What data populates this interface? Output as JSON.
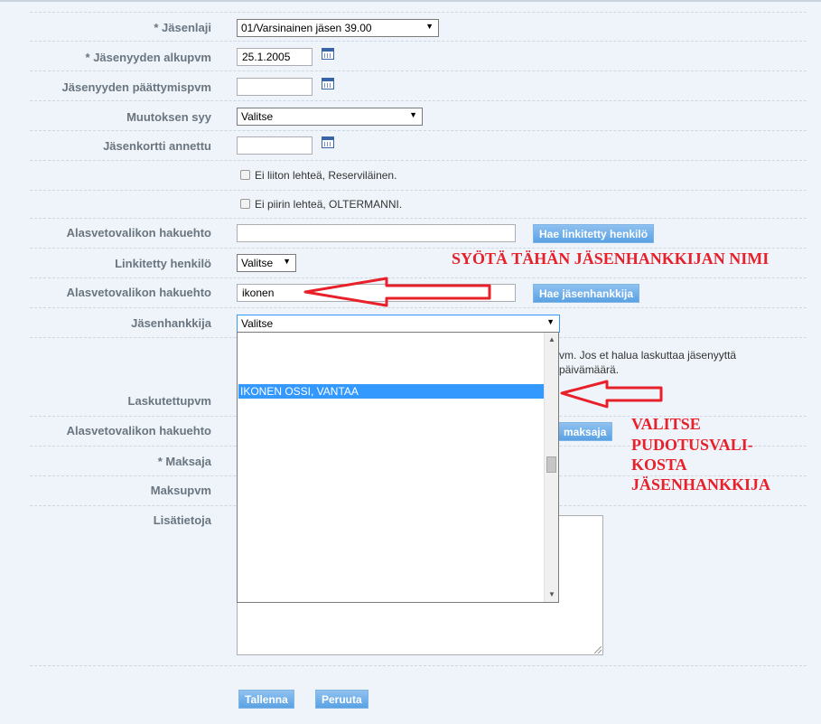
{
  "form": {
    "jasenlaji": {
      "label": "* Jäsenlaji",
      "value": "01/Varsinainen jäsen 39.00"
    },
    "alkupvm": {
      "label": "* Jäsenyyden alkupvm",
      "value": "25.1.2005"
    },
    "paattymispvm": {
      "label": "Jäsenyyden päättymispvm",
      "value": ""
    },
    "muutoksen_syy": {
      "label": "Muutoksen syy",
      "value": "Valitse"
    },
    "jasenkortti": {
      "label": "Jäsenkortti annettu",
      "value": ""
    },
    "ei_liiton_lehtea": {
      "label": "Ei liiton lehteä, Reserviläinen."
    },
    "ei_piirin_lehtea": {
      "label": "Ei piirin lehteä, OLTERMANNI."
    },
    "hakuehto1": {
      "label": "Alasvetovalikon hakuehto",
      "value": ""
    },
    "hae_linkitetty_button": "Hae linkitetty henkilö",
    "linkitetty": {
      "label": "Linkitetty henkilö",
      "value": "Valitse"
    },
    "hakuehto2": {
      "label": "Alasvetovalikon hakuehto",
      "value": "ikonen"
    },
    "hae_jasenhankkija_button": "Hae jäsenhankkija",
    "jasenhankkija": {
      "label": "Jäsenhankkija",
      "value": "Valitse",
      "options": [
        {
          "text": "IKONEN OSSI, VANTAA",
          "selected": true
        }
      ]
    },
    "laskutus_hint_line1": "vm. Jos et halua laskuttaa jäsenyyttä",
    "laskutus_hint_line2": "päivämäärä.",
    "laskutettupvm": {
      "label": "Laskutettupvm"
    },
    "hakuehto3": {
      "label": "Alasvetovalikon hakuehto"
    },
    "hae_maksaja_button": "maksaja",
    "maksaja": {
      "label": "* Maksaja"
    },
    "maksupvm": {
      "label": "Maksupvm"
    },
    "lisatietoja": {
      "label": "Lisätietoja"
    },
    "save_button": "Tallenna",
    "cancel_button": "Peruuta"
  },
  "annotations": {
    "syota": "SYÖTÄ TÄHÄN JÄSENHANKKIJAN NIMI",
    "valitse_lines": [
      "VALITSE",
      "PUDOTUSVALI-",
      "KOSTA",
      "JÄSENHANKKIJA"
    ]
  },
  "colors": {
    "annotation": "#e8202a",
    "button": "#5aa2e4",
    "selection": "#3399ff"
  }
}
